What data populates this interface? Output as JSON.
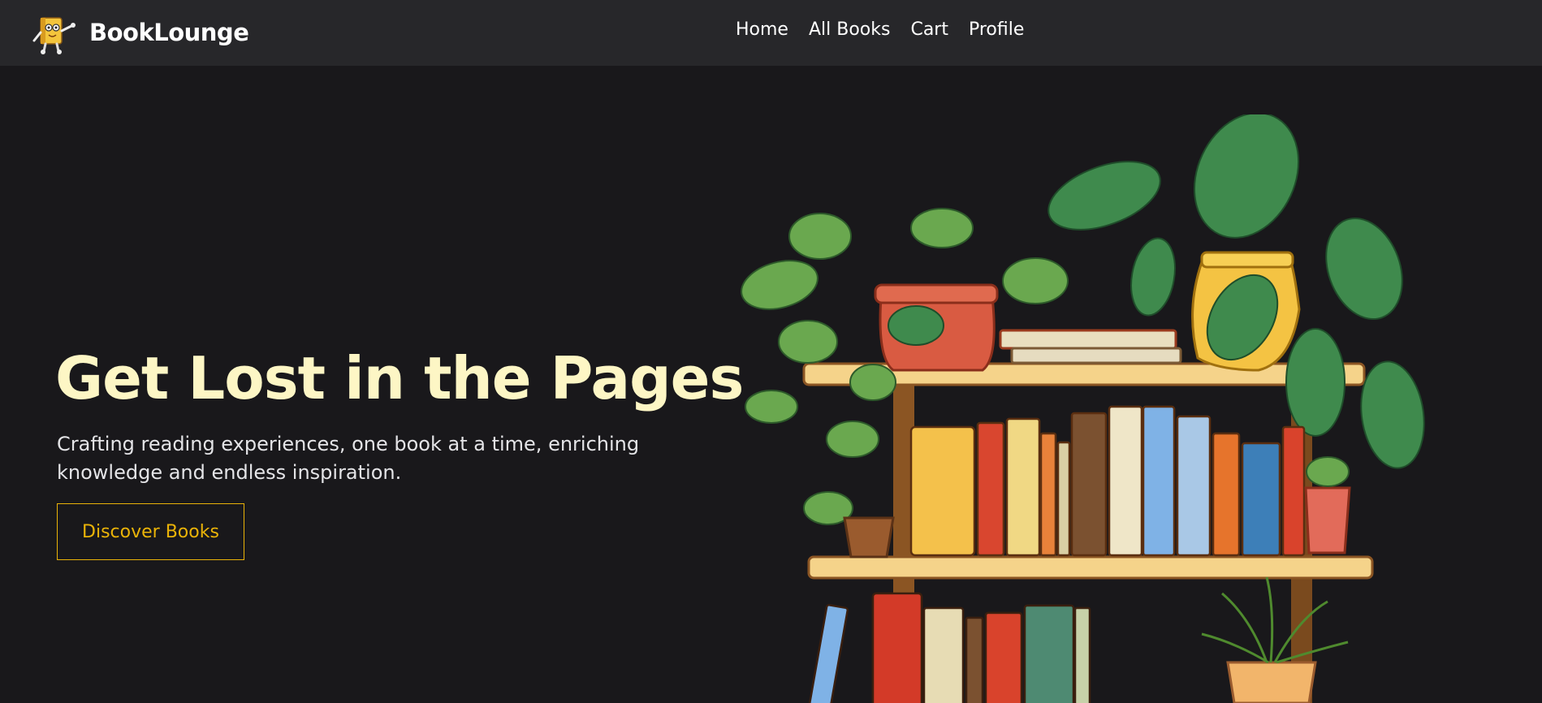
{
  "navbar": {
    "brand_name": "BookLounge",
    "logo_icon": "book-mascot-icon",
    "links": [
      {
        "label": "Home"
      },
      {
        "label": "All Books"
      },
      {
        "label": "Cart"
      },
      {
        "label": "Profile"
      }
    ]
  },
  "hero": {
    "title": "Get Lost in the Pages",
    "subtitle": "Crafting reading experiences, one book at a time, enriching knowledge and endless inspiration.",
    "cta_label": "Discover Books",
    "illustration": "bookshelf-with-plants-illustration"
  },
  "colors": {
    "nav_bg": "#27272a",
    "page_bg": "#19181b",
    "title": "#fdf6c5",
    "subtitle": "#e4e4e7",
    "accent": "#eab308"
  }
}
